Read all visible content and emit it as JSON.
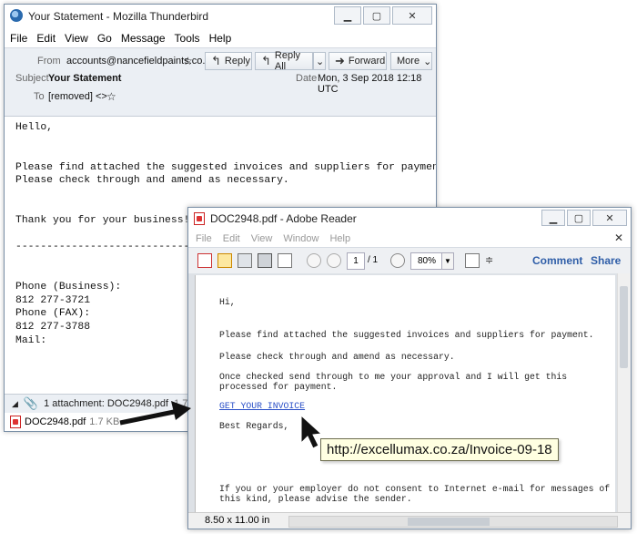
{
  "thunderbird": {
    "title": "Your Statement - Mozilla Thunderbird",
    "menu": [
      "File",
      "Edit",
      "View",
      "Go",
      "Message",
      "Tools",
      "Help"
    ],
    "from_label": "From",
    "from_value": "accounts@nancefieldpaints.co.za",
    "subject_label": "Subject",
    "subject_value": "Your Statement",
    "to_label": "To",
    "to_value": "[removed] <>",
    "date_label": "Date",
    "date_value": "Mon, 3 Sep 2018 12:18 UTC",
    "buttons": {
      "reply": "Reply",
      "reply_all": "Reply All",
      "forward": "Forward",
      "more": "More"
    },
    "body": "Hello,\n\n\nPlease find attached the suggested invoices and suppliers for payment.\nPlease check through and amend as necessary.\n\n\nThank you for your business!\n\n----------------------------------------------------------\n\n\nPhone (Business):\n812 277-3721\nPhone (FAX):\n812 277-3788\nMail:",
    "attachment_summary": "1 attachment: DOC2948.pdf",
    "attachment_summary_size": "1.7 KB",
    "attachment_name": "DOC2948.pdf",
    "attachment_size": "1.7 KB"
  },
  "reader": {
    "title": "DOC2948.pdf - Adobe Reader",
    "menu": [
      "File",
      "Edit",
      "View",
      "Window",
      "Help"
    ],
    "page_current": "1",
    "page_total": "/ 1",
    "zoom": "80%",
    "comment": "Comment",
    "share": "Share",
    "status": "8.50 x 11.00 in",
    "lines": {
      "hi": "Hi,",
      "p1": "Please find attached the suggested invoices and suppliers for payment.",
      "p2": "Please check through and amend as necessary.",
      "p3a": "Once checked send through to me your approval and I will get this",
      "p3b": "processed for payment.",
      "link": "GET YOUR INVOICE",
      "regards": "Best Regards,",
      "p4a": "If you or your employer do not consent to Internet e-mail for messages of",
      "p4b": "this kind, please advise the sender."
    }
  },
  "tooltip_url": "http://excellumax.co.za/Invoice-09-18"
}
